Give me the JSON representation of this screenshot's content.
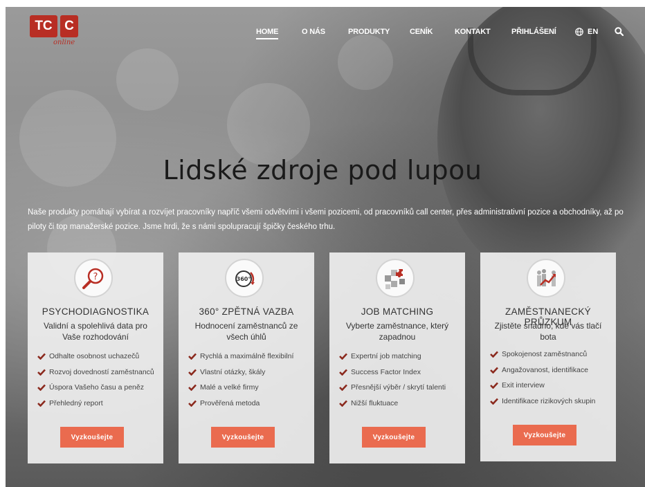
{
  "logo": {
    "text_left": "TC",
    "text_right": "C",
    "subtitle": "online"
  },
  "nav": {
    "items": [
      {
        "label": "HOME",
        "active": true
      },
      {
        "label": "O NÁS",
        "active": false
      },
      {
        "label": "PRODUKTY",
        "active": false
      },
      {
        "label": "CENÍK",
        "active": false
      },
      {
        "label": "KONTAKT",
        "active": false
      },
      {
        "label": "PŘIHLÁŠENÍ",
        "active": false
      }
    ],
    "language": "EN",
    "icons": [
      "globe-icon",
      "search-icon"
    ]
  },
  "hero": {
    "title": "Lidské zdroje pod lupou",
    "intro": "Naše produkty pomáhají vybírat a rozvíjet pracovníky napříč všemi odvětvími i všemi pozicemi, od pracovníků call center, přes administrativní pozice a obchodníky, až po piloty či top manažerské pozice. Jsme hrdi, že s námi spolupracují špičky českého trhu."
  },
  "colors": {
    "accent": "#ea6b4f",
    "brand": "#b82e24",
    "check": "#8b2a1e"
  },
  "cards": [
    {
      "icon": "magnifier-question-icon",
      "title": "PSYCHODIAGNOSTIKA",
      "subtitle": "Validní a spolehlivá data pro Vaše rozhodování",
      "items": [
        "Odhalte osobnost uchazečů",
        "Rozvoj dovedností zaměstnanců",
        "Úspora Vašeho času a peněz",
        "Přehledný report"
      ],
      "button": "Vyzkoušejte"
    },
    {
      "icon": "360-feedback-icon",
      "title": "360° ZPĚTNÁ VAZBA",
      "subtitle": "Hodnocení zaměstnanců ze všech úhlů",
      "items": [
        "Rychlá a maximálně flexibilní",
        "Vlastní otázky, škály",
        "Malé a velké firmy",
        "Prověřená metoda"
      ],
      "button": "Vyzkoušejte"
    },
    {
      "icon": "puzzle-icon",
      "title": "JOB MATCHING",
      "subtitle": "Vyberte zaměstnance, který zapadnou",
      "items": [
        "Expertní job matching",
        "Success Factor Index",
        "Přesnější výběr / skrytí talenti",
        "Nižší fluktuace"
      ],
      "button": "Vyzkoušejte"
    },
    {
      "icon": "people-chart-icon",
      "title": "ZAMĚSTNANECKÝ PRŮZKUM",
      "subtitle": "Zjistěte snadno, kde vás tlačí bota",
      "items": [
        "Spokojenost zaměstnanců",
        "Angažovanost, identifikace",
        "Exit interview",
        "Identifikace rizikových skupin"
      ],
      "button": "Vyzkoušejte"
    }
  ]
}
